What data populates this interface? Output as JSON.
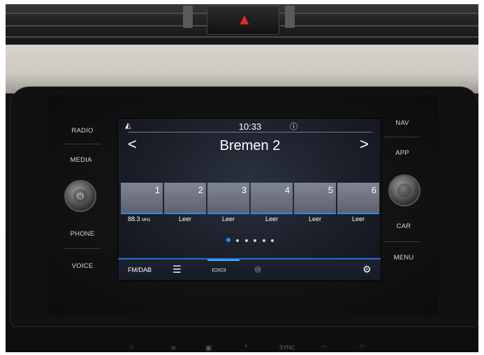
{
  "hardware": {
    "left_buttons": [
      "RADIO",
      "MEDIA",
      "PHONE",
      "VOICE"
    ],
    "right_buttons": [
      "NAV",
      "APP",
      "CAR",
      "MENU"
    ],
    "lower_label": "SYNC"
  },
  "status_bar": {
    "time": "10:33"
  },
  "station": {
    "name": "Bremen 2",
    "prev": "<",
    "next": ">"
  },
  "presets": [
    {
      "number": "1",
      "label": "88.3",
      "unit": "MHz",
      "active": true
    },
    {
      "number": "2",
      "label": "Leer"
    },
    {
      "number": "3",
      "label": "Leer"
    },
    {
      "number": "4",
      "label": "Leer"
    },
    {
      "number": "5",
      "label": "Leer"
    },
    {
      "number": "6",
      "label": "Leer"
    }
  ],
  "page_indicator": {
    "pages": 6,
    "current": 1
  },
  "bottom_bar": {
    "band_label": "FM/DAB",
    "icons": [
      "list-icon",
      "radio-tuner-icon",
      "broadcast-icon",
      "settings-icon"
    ]
  },
  "colors": {
    "accent": "#2d8cf0",
    "hazard": "#e22a22",
    "screen_bg": "#1b1f29"
  }
}
